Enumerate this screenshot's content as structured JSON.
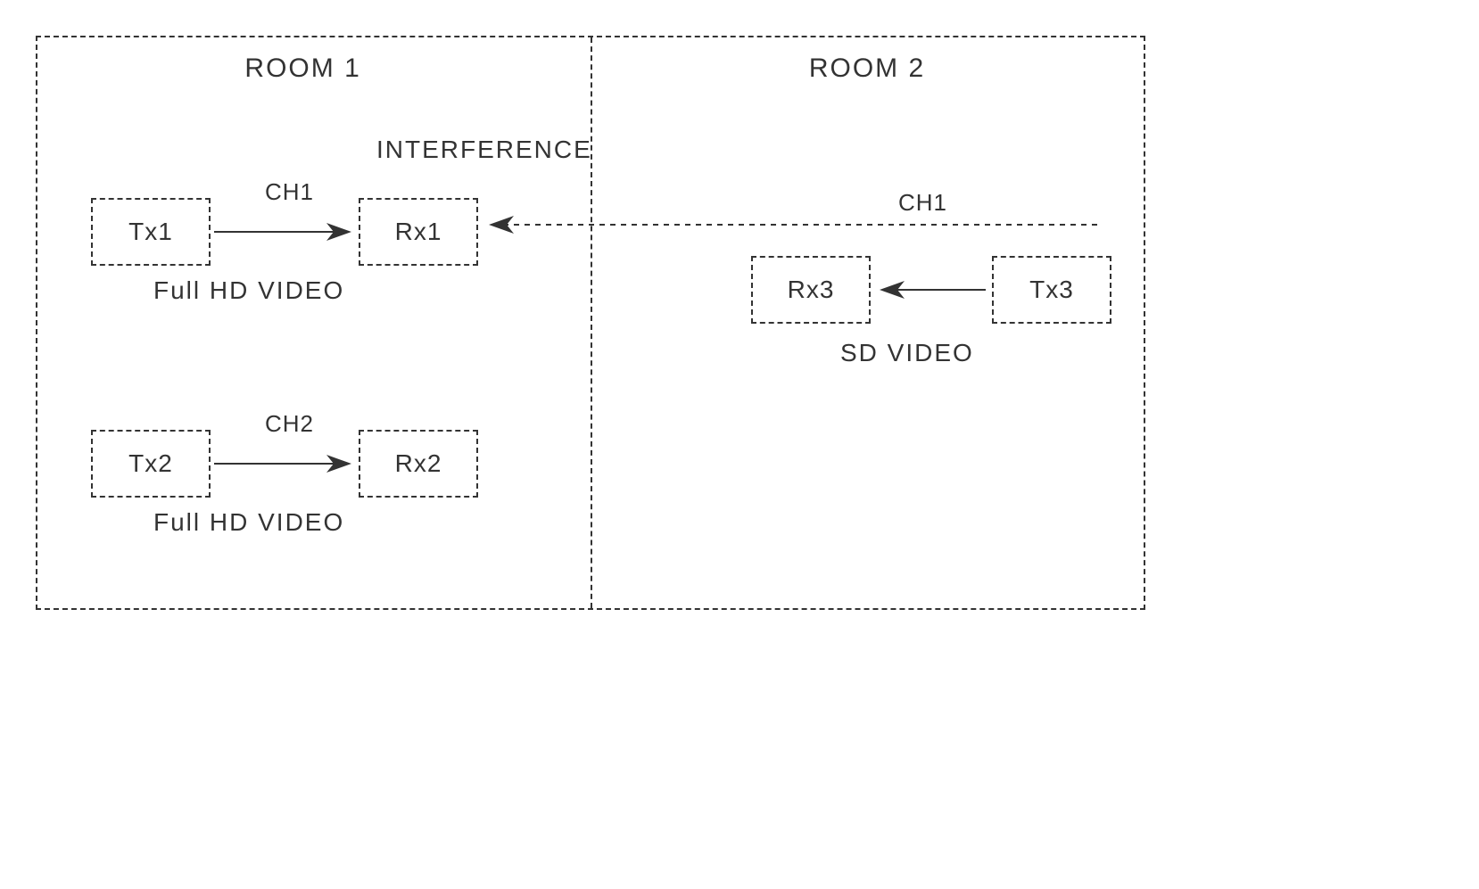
{
  "room1": {
    "label": "ROOM 1"
  },
  "room2": {
    "label": "ROOM 2"
  },
  "interference": "INTERFERENCE",
  "pairs": {
    "p1": {
      "tx": "Tx1",
      "rx": "Rx1",
      "ch": "CH1",
      "desc": "Full HD VIDEO"
    },
    "p2": {
      "tx": "Tx2",
      "rx": "Rx2",
      "ch": "CH2",
      "desc": "Full HD VIDEO"
    },
    "p3": {
      "tx": "Tx3",
      "rx": "Rx3",
      "ch": "CH1",
      "desc": "SD VIDEO"
    }
  }
}
